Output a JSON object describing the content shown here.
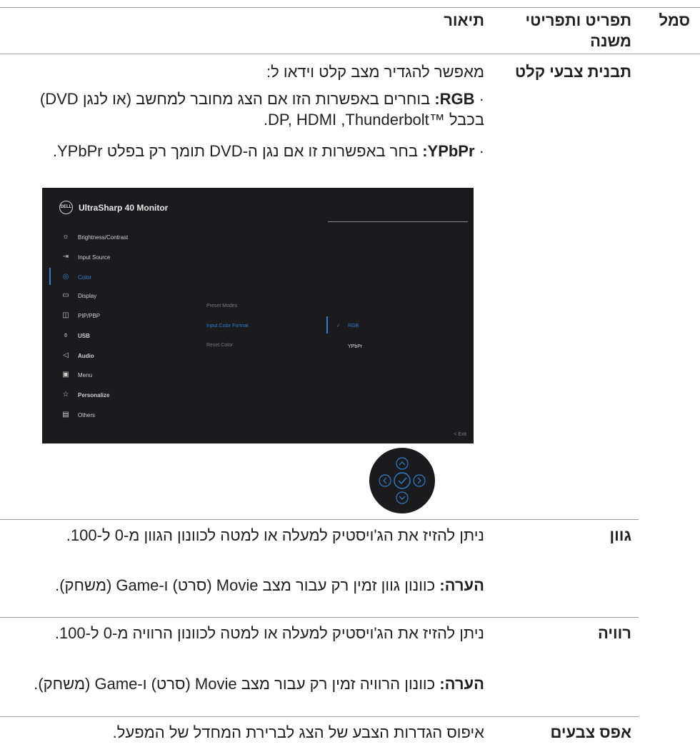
{
  "table": {
    "headers": {
      "icon": "סמל",
      "menu": "תפריט ותפריטי משנה",
      "description": "תיאור"
    },
    "rows": {
      "color_format": {
        "label": "תבנית צבעי קלט",
        "intro": "מאפשר להגדיר מצב קלט וידאו ל:",
        "bullet1_bold": "RGB:",
        "bullet1_text": " בוחרים באפשרות הזו אם הצג מחובר למחשב (או לנגן DVD) בכבל ™Thunderbolt‏, DP, HDMI.",
        "bullet2_bold": "YPbPr:",
        "bullet2_text": " בחר באפשרות זו אם נגן ה-DVD תומך רק בפלט YPbPr.",
        "bullet_mark": "·"
      },
      "hue": {
        "label": "גוון",
        "text": "ניתן להזיז את הג'ויסטיק למעלה או למטה לכוונון הגוון מ-0 ל-100.",
        "note_bold": "הערה:",
        "note_text": " כוונון גוון זמין רק עבור מצב Movie (סרט) ו-Game (משחק)."
      },
      "saturation": {
        "label": "רוויה",
        "text": "ניתן להזיז את הג'ויסטיק למעלה או למטה לכוונון הרוויה מ-0 ל-100.",
        "note_bold": "הערה:",
        "note_text": " כוונון הרוויה זמין רק עבור מצב Movie (סרט) ו-Game (משחק)."
      },
      "reset": {
        "label": "אפס צבעים",
        "text": "איפוס הגדרות הצבע של הצג לברירת המחדל של המפעל."
      }
    }
  },
  "osd": {
    "logo": "DELL",
    "title": "UltraSharp 40 Monitor",
    "menu": [
      {
        "label": "Brightness/Contrast",
        "icon": "brightness-icon"
      },
      {
        "label": "Input Source",
        "icon": "input-source-icon"
      },
      {
        "label": "Color",
        "icon": "color-palette-icon",
        "active": true
      },
      {
        "label": "Display",
        "icon": "display-icon"
      },
      {
        "label": "PIP/PBP",
        "icon": "pip-pbp-icon"
      },
      {
        "label": "USB",
        "icon": "usb-mouse-icon"
      },
      {
        "label": "Audio",
        "icon": "audio-speaker-icon"
      },
      {
        "label": "Menu",
        "icon": "menu-icon"
      },
      {
        "label": "Personalize",
        "icon": "star-icon"
      },
      {
        "label": "Others",
        "icon": "others-icon"
      }
    ],
    "submenu": [
      "Preset Modes",
      "Input Color Format",
      "Reset Color"
    ],
    "options": {
      "rgb": "RGB",
      "ypbpr": "YPbPr",
      "check": "✓"
    },
    "exit": "Exit",
    "exit_arrow": "<"
  },
  "colors": {
    "accent": "#2d7fd1",
    "osd_bg": "#1b1b1d",
    "rule": "#9a9a9a"
  }
}
